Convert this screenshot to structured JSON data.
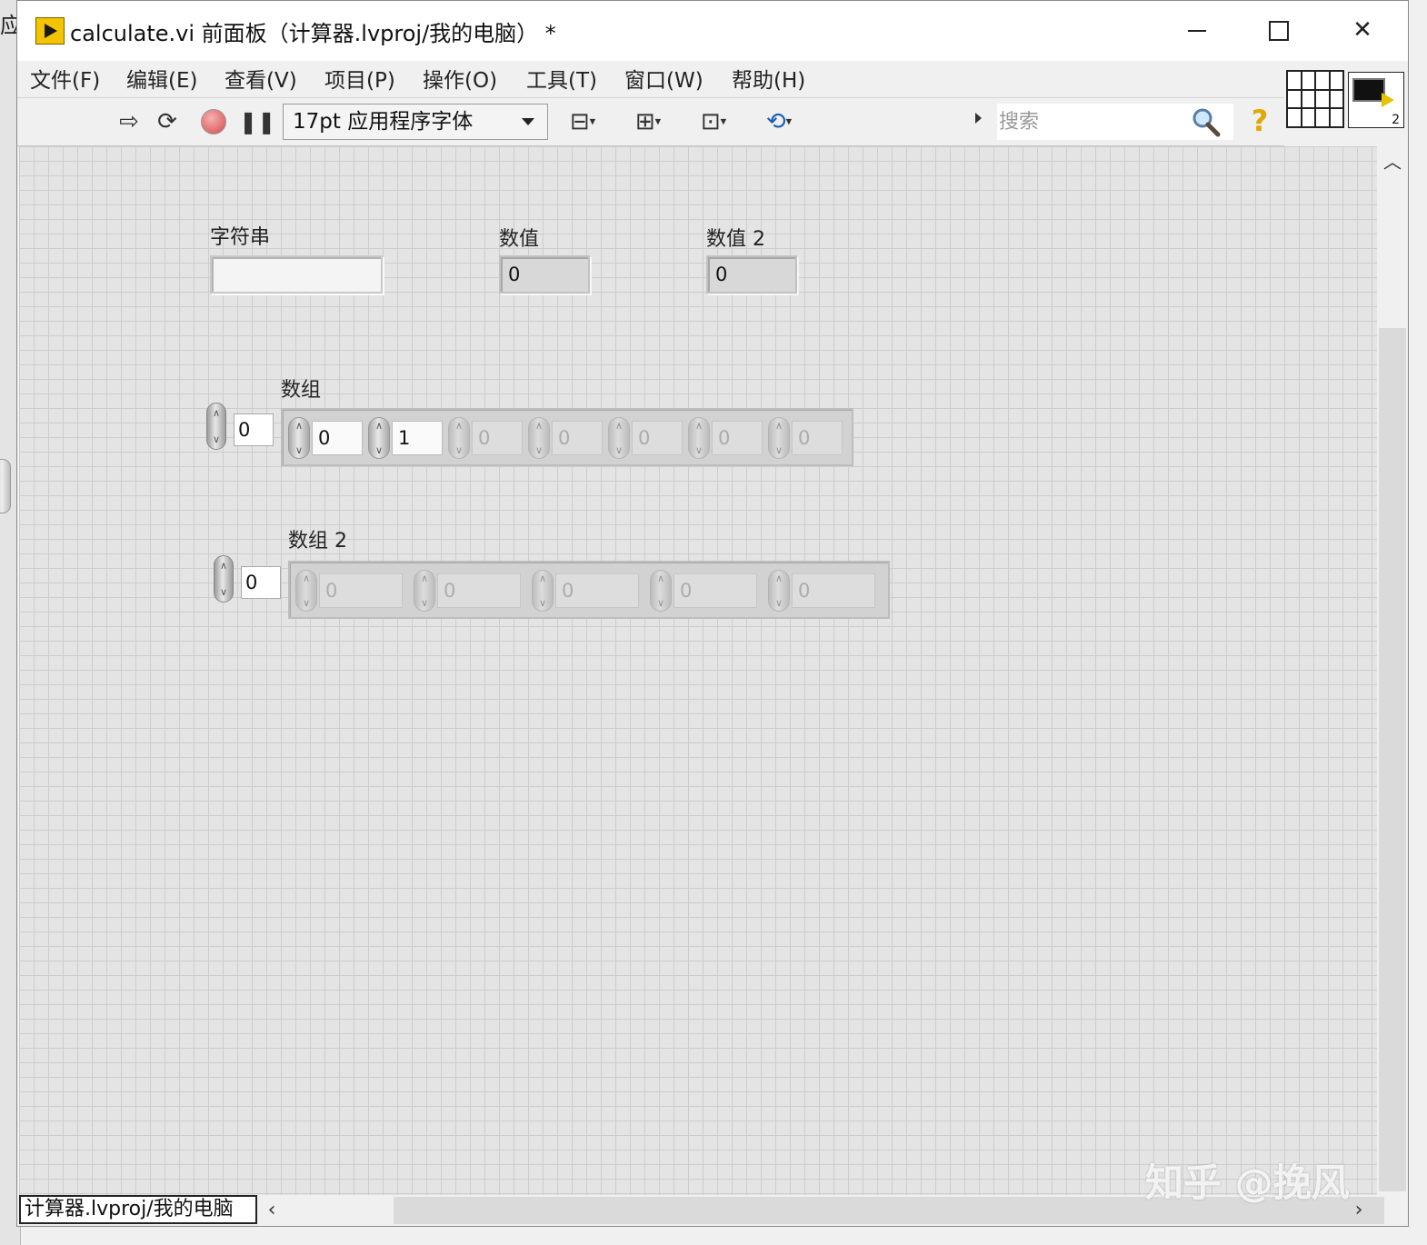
{
  "background_window": {
    "title_fragment": "应"
  },
  "window": {
    "title": "calculate.vi 前面板（计算器.lvproj/我的电脑） *",
    "controls": {
      "minimize": "minimize",
      "maximize": "maximize",
      "close": "close"
    }
  },
  "menu": [
    {
      "label": "文件(F)"
    },
    {
      "label": "编辑(E)"
    },
    {
      "label": "查看(V)"
    },
    {
      "label": "项目(P)"
    },
    {
      "label": "操作(O)"
    },
    {
      "label": "工具(T)"
    },
    {
      "label": "窗口(W)"
    },
    {
      "label": "帮助(H)"
    }
  ],
  "toolbar": {
    "font": "17pt 应用程序字体",
    "search_placeholder": "搜索",
    "icons": [
      "run-arrow-icon",
      "run-continuously-icon",
      "abort-icon",
      "pause-icon",
      "align-objects-icon",
      "distribute-objects-icon",
      "resize-objects-icon",
      "reorder-icon",
      "search-icon",
      "help-icon"
    ]
  },
  "icon_pane": {
    "vi_icon_number": "2"
  },
  "front_panel": {
    "string_control": {
      "label": "字符串",
      "value": ""
    },
    "numeric_1": {
      "label": "数值",
      "value": "0"
    },
    "numeric_2": {
      "label": "数值 2",
      "value": "0"
    },
    "array_1": {
      "label": "数组",
      "index": "0",
      "elements": [
        "0",
        "1",
        "0",
        "0",
        "0",
        "0",
        "0"
      ],
      "active_count": 2
    },
    "array_2": {
      "label": "数组 2",
      "index": "0",
      "elements": [
        "0",
        "0",
        "0",
        "0",
        "0"
      ],
      "active_count": 0
    }
  },
  "statusbar": {
    "context": "计算器.lvproj/我的电脑"
  },
  "watermark": "知乎 @挽风",
  "colors": {
    "panel_bg": "#e4e4e4",
    "grid_line": "#cdcdcd",
    "vi_icon_yellow": "#f3c400"
  }
}
